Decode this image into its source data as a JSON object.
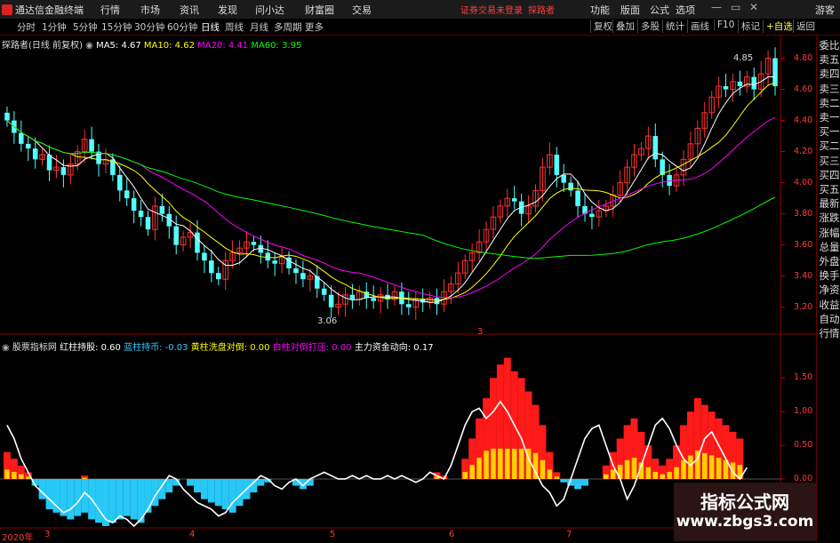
{
  "app": {
    "title": "通达信金融终端"
  },
  "menu": [
    "行情",
    "市场",
    "资讯",
    "发现",
    "问小达",
    "财富圈",
    "交易"
  ],
  "warning": "证券交易未登录",
  "user_link": "探路者",
  "right_menu": [
    "功能",
    "版面",
    "公式",
    "选项"
  ],
  "guest": "游客",
  "periods": [
    "分时",
    "1分钟",
    "5分钟",
    "15分钟",
    "30分钟",
    "60分钟",
    "日线",
    "周线",
    "月线",
    "多周期",
    "更多"
  ],
  "active_period": "日线",
  "toolbar_buttons": [
    "复权",
    "叠加",
    "多股",
    "统计",
    "画线",
    "F10",
    "标记",
    "+自选",
    "返回"
  ],
  "main_legend": {
    "name": "探路者(日线 前复权)",
    "ma5": "MA5: 4.67",
    "ma10": "MA10: 4.62",
    "ma20": "MA20: 4.41",
    "ma60": "MA60: 3.95",
    "colors": {
      "ma5": "#ffffff",
      "ma10": "#ffff00",
      "ma20": "#ff00ff",
      "ma60": "#00ff00"
    }
  },
  "indicator_legend": {
    "name": "股票指标网",
    "red": "红柱持股: 0.60",
    "blue": "蓝柱持币: -0.03",
    "yellow": "黄柱洗盘对倒: 0.00",
    "white": "白柱对倒打压: 0.00",
    "main": "主力资金动向: 0.17"
  },
  "price_axis": [
    "4.80",
    "4.60",
    "4.40",
    "4.20",
    "4.00",
    "3.80",
    "3.60",
    "3.40",
    "3.20"
  ],
  "ind_axis": [
    "1.50",
    "1.00",
    "0.50",
    "0.00",
    "-0.50"
  ],
  "high_label": "4.85",
  "low_label": "3.06",
  "date_labels": [
    "2020年",
    "3",
    "4",
    "5",
    "6",
    "7"
  ],
  "month_marker": "3",
  "right_panel": [
    "委比",
    "卖五",
    "卖四",
    "卖三",
    "卖二",
    "卖一",
    "买一",
    "买二",
    "买三",
    "买四",
    "买五",
    "最新",
    "涨跌",
    "涨幅",
    "总量",
    "外盘",
    "换手",
    "净资",
    "收益",
    "自动",
    "行情"
  ],
  "watermark": {
    "line1": "指标公式网",
    "line2": "www.zbgs3.com"
  },
  "chart_data": [
    {
      "type": "candlestick",
      "ylim": [
        3.05,
        4.9
      ],
      "open": [
        4.45,
        4.4,
        4.32,
        4.25,
        4.22,
        4.15,
        4.18,
        4.08,
        4.1,
        4.05,
        4.12,
        4.2,
        4.28,
        4.2,
        4.12,
        4.15,
        4.05,
        3.95,
        3.9,
        3.82,
        3.78,
        3.7,
        3.85,
        3.8,
        3.72,
        3.6,
        3.65,
        3.68,
        3.55,
        3.5,
        3.42,
        3.38,
        3.5,
        3.55,
        3.58,
        3.62,
        3.6,
        3.55,
        3.5,
        3.48,
        3.52,
        3.45,
        3.42,
        3.38,
        3.4,
        3.32,
        3.28,
        3.2,
        3.22,
        3.28,
        3.25,
        3.3,
        3.26,
        3.24,
        3.28,
        3.25,
        3.3,
        3.22,
        3.2,
        3.25,
        3.23,
        3.26,
        3.22,
        3.3,
        3.35,
        3.42,
        3.5,
        3.55,
        3.62,
        3.7,
        3.78,
        3.85,
        3.9,
        3.88,
        3.8,
        3.85,
        3.95,
        4.1,
        4.18,
        4.05,
        4.0,
        3.95,
        3.85,
        3.8,
        3.78,
        3.82,
        3.85,
        3.92,
        4.0,
        4.1,
        4.18,
        4.22,
        4.3,
        4.15,
        4.05,
        3.98,
        4.05,
        4.15,
        4.25,
        4.35,
        4.45,
        4.55,
        4.62,
        4.6,
        4.65,
        4.62,
        4.68,
        4.6,
        4.7,
        4.8
      ],
      "close": [
        4.4,
        4.32,
        4.25,
        4.22,
        4.15,
        4.18,
        4.08,
        4.1,
        4.05,
        4.12,
        4.2,
        4.28,
        4.2,
        4.12,
        4.15,
        4.05,
        3.95,
        3.9,
        3.82,
        3.78,
        3.7,
        3.85,
        3.8,
        3.72,
        3.6,
        3.65,
        3.68,
        3.55,
        3.5,
        3.42,
        3.38,
        3.5,
        3.55,
        3.58,
        3.62,
        3.6,
        3.55,
        3.5,
        3.48,
        3.52,
        3.45,
        3.42,
        3.38,
        3.4,
        3.32,
        3.28,
        3.2,
        3.22,
        3.28,
        3.25,
        3.3,
        3.26,
        3.24,
        3.28,
        3.25,
        3.3,
        3.22,
        3.2,
        3.25,
        3.23,
        3.26,
        3.22,
        3.3,
        3.35,
        3.42,
        3.5,
        3.55,
        3.62,
        3.7,
        3.78,
        3.85,
        3.9,
        3.88,
        3.8,
        3.85,
        3.95,
        4.1,
        4.18,
        4.05,
        4.0,
        3.95,
        3.85,
        3.8,
        3.78,
        3.82,
        3.85,
        3.92,
        4.0,
        4.1,
        4.18,
        4.22,
        4.3,
        4.15,
        4.05,
        3.98,
        4.05,
        4.15,
        4.25,
        4.35,
        4.45,
        4.55,
        4.62,
        4.6,
        4.65,
        4.62,
        4.68,
        4.6,
        4.7,
        4.8,
        4.62
      ]
    },
    {
      "type": "bar",
      "ylim": [
        -0.7,
        1.9
      ],
      "series": [
        {
          "name": "红柱持股",
          "values": [
            0.4,
            0.3,
            0.2,
            0.1,
            0,
            0,
            0,
            0,
            0,
            0,
            0,
            0.05,
            0,
            0,
            0,
            0,
            0,
            0,
            0,
            0,
            0,
            0,
            0,
            0,
            0,
            0,
            0,
            0,
            0,
            0,
            0,
            0,
            0,
            0,
            0,
            0,
            0,
            0,
            0,
            0,
            0,
            0,
            0,
            0,
            0,
            0,
            0,
            0,
            0,
            0,
            0,
            0,
            0,
            0,
            0,
            0,
            0,
            0,
            0,
            0,
            0,
            0.1,
            0.05,
            0,
            0,
            0.3,
            0.6,
            0.9,
            1.2,
            1.5,
            1.7,
            1.8,
            1.6,
            1.5,
            1.3,
            1.1,
            0.8,
            0.4,
            0.1,
            0,
            0,
            0,
            0,
            0,
            0,
            0.2,
            0.4,
            0.6,
            0.8,
            0.9,
            0.7,
            0.5,
            0.3,
            0.2,
            0.3,
            0.5,
            0.8,
            1.0,
            1.2,
            1.1,
            1.0,
            0.9,
            0.8,
            0.7,
            0.6
          ]
        },
        {
          "name": "蓝柱持币",
          "values": [
            0,
            0,
            0,
            0,
            -0.1,
            -0.3,
            -0.45,
            -0.5,
            -0.55,
            -0.6,
            -0.55,
            -0.5,
            -0.6,
            -0.65,
            -0.7,
            -0.65,
            -0.6,
            -0.55,
            -0.6,
            -0.65,
            -0.5,
            -0.4,
            -0.3,
            -0.2,
            -0.1,
            0,
            -0.1,
            -0.2,
            -0.3,
            -0.35,
            -0.4,
            -0.45,
            -0.5,
            -0.4,
            -0.3,
            -0.2,
            -0.1,
            -0.05,
            0,
            0,
            0,
            -0.1,
            -0.15,
            -0.1,
            0,
            0,
            0,
            0,
            0,
            0,
            0,
            0,
            0,
            0,
            0,
            0,
            0,
            0,
            0,
            0,
            0,
            0,
            0,
            0,
            0,
            0,
            0,
            0,
            0,
            0,
            0,
            0,
            0,
            0,
            0,
            0,
            0,
            0,
            0,
            -0.05,
            -0.1,
            -0.15,
            -0.1,
            0,
            0,
            0,
            0,
            0,
            0,
            0,
            0,
            0,
            0,
            0,
            0,
            0,
            0,
            0,
            0,
            0,
            0,
            0,
            0,
            0,
            0,
            0,
            0
          ]
        },
        {
          "name": "主力资金动向",
          "values": [
            0.8,
            0.6,
            0.3,
            0.1,
            -0.1,
            -0.2,
            -0.3,
            -0.4,
            -0.5,
            -0.45,
            -0.35,
            -0.2,
            -0.3,
            -0.45,
            -0.6,
            -0.65,
            -0.55,
            -0.6,
            -0.7,
            -0.6,
            -0.45,
            -0.25,
            -0.1,
            0.05,
            0.0,
            -0.15,
            -0.25,
            -0.35,
            -0.4,
            -0.45,
            -0.55,
            -0.5,
            -0.35,
            -0.25,
            -0.15,
            -0.05,
            0.05,
            0.0,
            -0.1,
            -0.15,
            -0.05,
            0.0,
            -0.1,
            0.0,
            0.05,
            0.1,
            0.05,
            0.0,
            0.0,
            0.05,
            0.0,
            0.05,
            0.0,
            0.0,
            0.05,
            0.0,
            0.05,
            0.0,
            -0.05,
            0.0,
            0.1,
            0.05,
            0.0,
            0.2,
            0.5,
            0.8,
            1.0,
            1.05,
            0.9,
            1.0,
            1.15,
            1.0,
            0.8,
            0.6,
            0.3,
            0.1,
            -0.1,
            -0.2,
            -0.4,
            -0.3,
            0.0,
            0.3,
            0.6,
            0.75,
            0.8,
            0.5,
            0.2,
            0.0,
            -0.3,
            -0.1,
            0.2,
            0.5,
            0.8,
            0.9,
            0.75,
            0.5,
            0.3,
            0.2,
            0.3,
            0.6,
            0.7,
            0.5,
            0.3,
            0.1,
            0.0,
            0.17
          ]
        }
      ]
    }
  ]
}
